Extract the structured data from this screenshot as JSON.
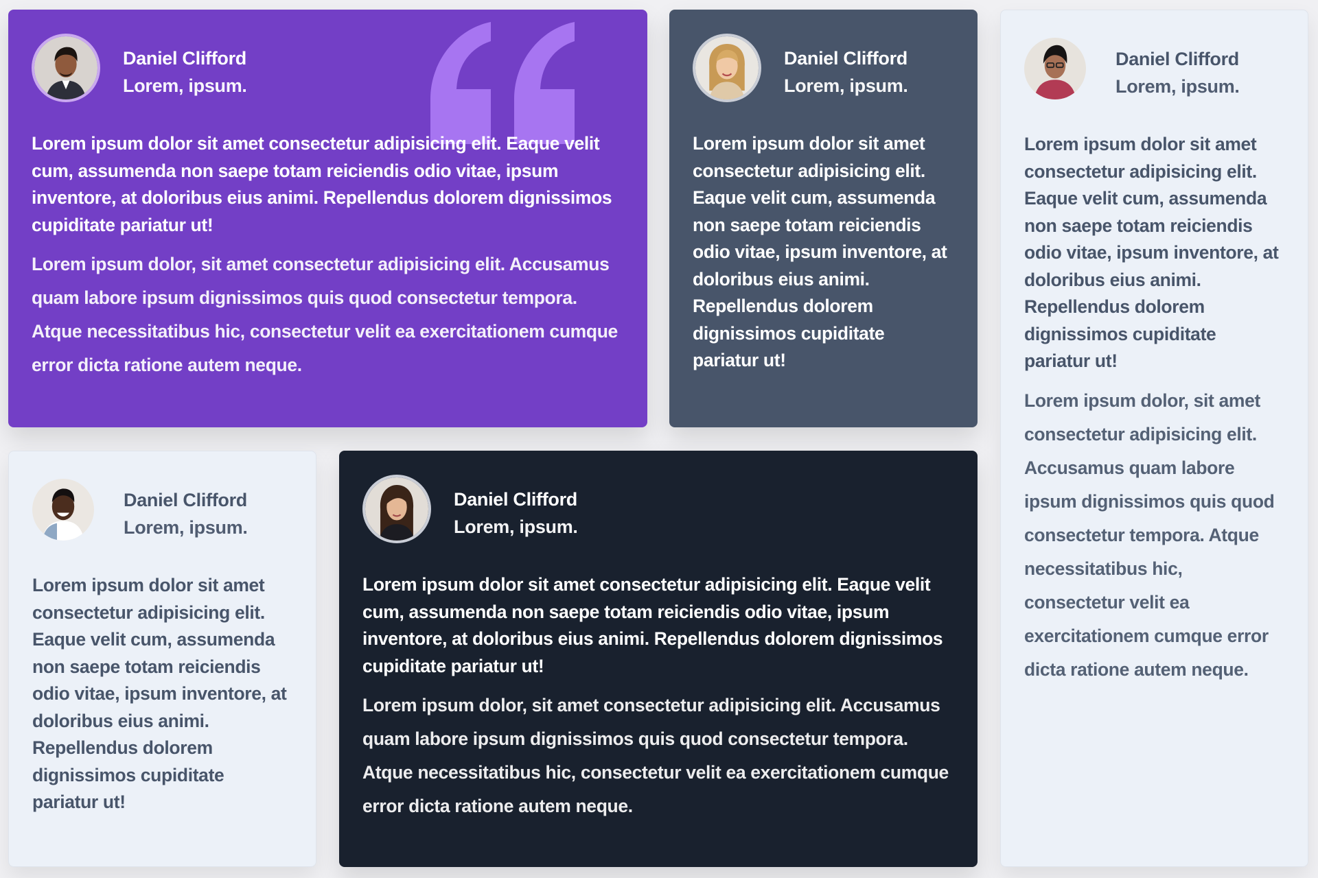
{
  "colors": {
    "page_bg": "#f0f0f3",
    "purple": "#733fc6",
    "slate": "#48556a",
    "light": "#ecf1f8",
    "dark": "#19212e",
    "quote_mark": "#a775f1"
  },
  "testimonials": [
    {
      "name": "Daniel Clifford",
      "role": "Lorem, ipsum.",
      "avatar_icon": "man-portrait-avatar",
      "quote_icon": "quotation-mark-icon",
      "text1": "Lorem ipsum dolor sit amet consectetur adipisicing elit. Eaque velit cum, assumenda non saepe totam reiciendis odio vitae, ipsum inventore, at doloribus eius animi. Repellendus dolorem dignissimos cupiditate pariatur ut!",
      "text2": "Lorem ipsum dolor, sit amet consectetur adipisicing elit. Accusamus quam labore ipsum dignissimos quis quod consectetur tempora. Atque necessitatibus hic, consectetur velit ea exercitationem cumque error dicta ratione autem neque."
    },
    {
      "name": "Daniel Clifford",
      "role": "Lorem, ipsum.",
      "avatar_icon": "woman-portrait-avatar",
      "text1": "Lorem ipsum dolor sit amet consectetur adipisicing elit. Eaque velit cum, assumenda non saepe totam reiciendis odio vitae, ipsum inventore, at doloribus eius animi. Repellendus dolorem dignissimos cupiditate pariatur ut!"
    },
    {
      "name": "Daniel Clifford",
      "role": "Lorem, ipsum.",
      "avatar_icon": "man-portrait-avatar",
      "text1": "Lorem ipsum dolor sit amet consectetur adipisicing elit. Eaque velit cum, assumenda non saepe totam reiciendis odio vitae, ipsum inventore, at doloribus eius animi. Repellendus dolorem dignissimos cupiditate pariatur ut!",
      "text2": "Lorem ipsum dolor, sit amet consectetur adipisicing elit. Accusamus quam labore ipsum dignissimos quis quod consectetur tempora. Atque necessitatibus hic, consectetur velit ea exercitationem cumque error dicta ratione autem neque."
    },
    {
      "name": "Daniel Clifford",
      "role": "Lorem, ipsum.",
      "avatar_icon": "man-portrait-avatar",
      "text1": "Lorem ipsum dolor sit amet consectetur adipisicing elit. Eaque velit cum, assumenda non saepe totam reiciendis odio vitae, ipsum inventore, at doloribus eius animi. Repellendus dolorem dignissimos cupiditate pariatur ut!"
    },
    {
      "name": "Daniel Clifford",
      "role": "Lorem, ipsum.",
      "avatar_icon": "woman-portrait-avatar",
      "text1": "Lorem ipsum dolor sit amet consectetur adipisicing elit. Eaque velit cum, assumenda non saepe totam reiciendis odio vitae, ipsum inventore, at doloribus eius animi. Repellendus dolorem dignissimos cupiditate pariatur ut!",
      "text2": "Lorem ipsum dolor, sit amet consectetur adipisicing elit. Accusamus quam labore ipsum dignissimos quis quod consectetur tempora. Atque necessitatibus hic, consectetur velit ea exercitationem cumque error dicta ratione autem neque."
    }
  ]
}
